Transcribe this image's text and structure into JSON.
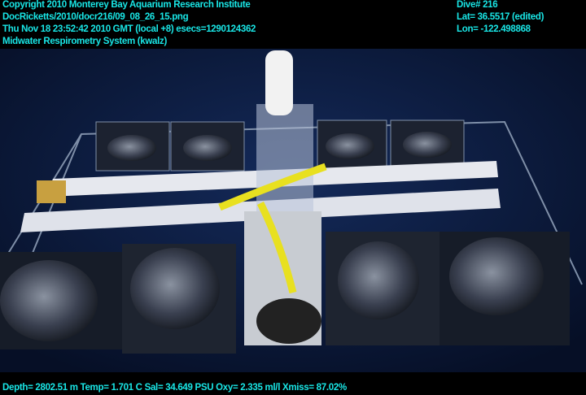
{
  "overlay_top_left": {
    "copyright": "Copyright 2010 Monterey Bay Aquarium Research Institute",
    "file_path": "DocRicketts/2010/docr216/09_08_26_15.png",
    "timestamp": "Thu Nov 18 23:52:42 2010 GMT (local +8)  esecs=1290124362",
    "project": "Midwater Respirometry System (kwalz)"
  },
  "overlay_top_right": {
    "dive": "Dive# 216",
    "lat": "Lat= 36.5517 (edited)",
    "lon": "Lon= -122.498868"
  },
  "overlay_bottom": {
    "sensors": "Depth= 2802.51 m  Temp= 1.701 C  Sal= 34.649 PSU  Oxy= 2.335 ml/l  Xmiss= 87.02%"
  }
}
